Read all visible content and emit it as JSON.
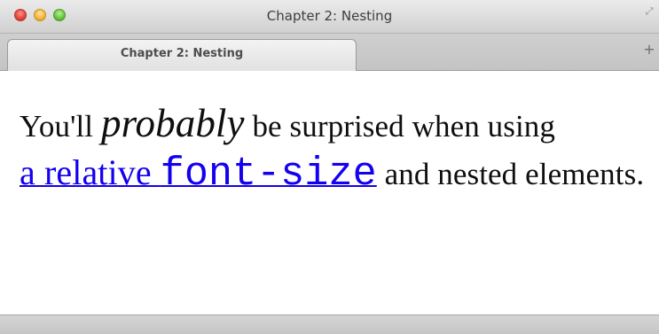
{
  "window": {
    "title": "Chapter 2: Nesting"
  },
  "tabs": [
    {
      "label": "Chapter 2: Nesting",
      "active": true
    }
  ],
  "toolbar": {
    "new_tab_label": "+"
  },
  "content": {
    "text_before_emphasis": "You'll ",
    "emphasis": "probably",
    "text_after_emphasis": " be surprised when using ",
    "link_text_part1": "a relative ",
    "link_code_text": "font-size",
    "text_after_link": " and nested elements."
  },
  "colors": {
    "link": "#1300ee",
    "text": "#0f0f0f",
    "page_background": "#ffffff"
  },
  "icons": {
    "traffic_lights": [
      "close-icon",
      "minimize-icon",
      "maximize-icon"
    ],
    "fullscreen": "fullscreen-icon",
    "new_tab": "plus-icon"
  }
}
